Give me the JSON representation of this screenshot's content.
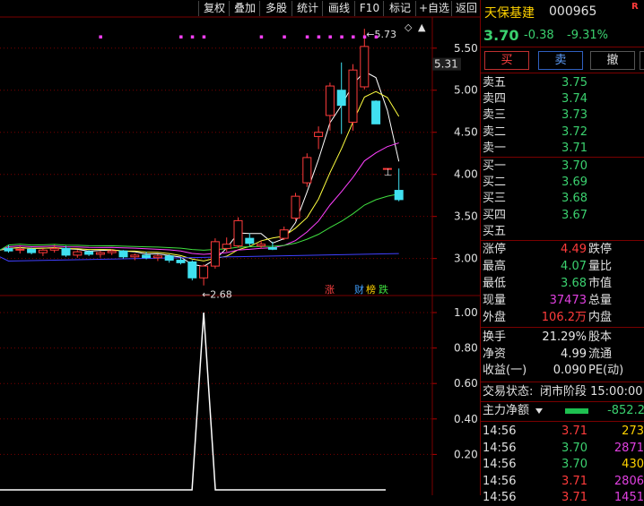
{
  "toolbar": {
    "items": [
      "复权",
      "叠加",
      "多股",
      "统计",
      "画线",
      "F10",
      "标记",
      "+自选",
      "返回"
    ]
  },
  "chart_data": [
    {
      "type": "candlestick",
      "title": "",
      "y_ticks": [
        "5.50",
        "5.00",
        "4.50",
        "4.00",
        "3.50",
        "3.00"
      ],
      "ylim": [
        2.56,
        5.87
      ],
      "last_close_tag": "5.31",
      "annotations": {
        "high": "5.73",
        "low": "2.68",
        "high_marker": "←",
        "low_marker": "←",
        "right_marker": "⊥",
        "marker_dots": "▪"
      },
      "signal_badges": [
        "涨",
        "财",
        "榜",
        "跌"
      ],
      "candles": [
        {
          "o": 3.12,
          "h": 3.16,
          "l": 3.07,
          "c": 3.09
        },
        {
          "o": 3.1,
          "h": 3.14,
          "l": 3.06,
          "c": 3.11
        },
        {
          "o": 3.11,
          "h": 3.13,
          "l": 3.05,
          "c": 3.07
        },
        {
          "o": 3.07,
          "h": 3.12,
          "l": 3.03,
          "c": 3.1
        },
        {
          "o": 3.1,
          "h": 3.16,
          "l": 3.07,
          "c": 3.12
        },
        {
          "o": 3.12,
          "h": 3.15,
          "l": 3.02,
          "c": 3.04
        },
        {
          "o": 3.04,
          "h": 3.1,
          "l": 3.01,
          "c": 3.08
        },
        {
          "o": 3.08,
          "h": 3.1,
          "l": 3.03,
          "c": 3.05
        },
        {
          "o": 3.05,
          "h": 3.09,
          "l": 3.01,
          "c": 3.07
        },
        {
          "o": 3.07,
          "h": 3.11,
          "l": 3.04,
          "c": 3.09
        },
        {
          "o": 3.09,
          "h": 3.1,
          "l": 3.0,
          "c": 3.02
        },
        {
          "o": 3.02,
          "h": 3.06,
          "l": 2.98,
          "c": 3.04
        },
        {
          "o": 3.04,
          "h": 3.08,
          "l": 2.99,
          "c": 3.01
        },
        {
          "o": 3.01,
          "h": 3.05,
          "l": 2.97,
          "c": 3.03
        },
        {
          "o": 3.03,
          "h": 3.05,
          "l": 2.95,
          "c": 2.98
        },
        {
          "o": 2.98,
          "h": 3.01,
          "l": 2.93,
          "c": 2.95
        },
        {
          "o": 2.96,
          "h": 2.98,
          "l": 2.74,
          "c": 2.77
        },
        {
          "o": 2.77,
          "h": 2.93,
          "l": 2.68,
          "c": 2.91
        },
        {
          "o": 2.91,
          "h": 3.24,
          "l": 2.88,
          "c": 3.2
        },
        {
          "o": 3.12,
          "h": 3.25,
          "l": 3.08,
          "c": 3.17
        },
        {
          "o": 3.15,
          "h": 3.49,
          "l": 3.13,
          "c": 3.45
        },
        {
          "o": 3.24,
          "h": 3.3,
          "l": 3.15,
          "c": 3.18
        },
        {
          "o": 3.15,
          "h": 3.21,
          "l": 3.12,
          "c": 3.17
        },
        {
          "o": 3.13,
          "h": 3.2,
          "l": 3.1,
          "c": 3.11
        },
        {
          "o": 3.24,
          "h": 3.38,
          "l": 3.22,
          "c": 3.34
        },
        {
          "o": 3.48,
          "h": 3.78,
          "l": 3.45,
          "c": 3.74
        },
        {
          "o": 3.9,
          "h": 4.25,
          "l": 3.85,
          "c": 4.2
        },
        {
          "o": 4.45,
          "h": 4.57,
          "l": 4.3,
          "c": 4.5
        },
        {
          "o": 4.7,
          "h": 5.09,
          "l": 4.52,
          "c": 5.05
        },
        {
          "o": 5.0,
          "h": 5.33,
          "l": 4.48,
          "c": 4.82
        },
        {
          "o": 4.62,
          "h": 5.31,
          "l": 4.52,
          "c": 5.24
        },
        {
          "o": 5.04,
          "h": 5.73,
          "l": 5.01,
          "c": 5.52
        },
        {
          "o": 4.87,
          "h": 4.88,
          "l": 4.78,
          "c": 4.6
        },
        {
          "o": 4.07,
          "h": 4.07,
          "l": 4.07,
          "c": 4.07
        },
        {
          "o": 3.81,
          "h": 4.07,
          "l": 3.68,
          "c": 3.7
        }
      ],
      "ma_lines": [
        "white",
        "yellow",
        "magenta",
        "green",
        "blue"
      ]
    },
    {
      "type": "line",
      "title": "",
      "y_ticks": [
        "1.00",
        "0.80",
        "0.60",
        "0.40",
        "0.20"
      ],
      "ylim": [
        0.0,
        1.0
      ],
      "series": [
        {
          "values": [
            0,
            0,
            0,
            0,
            0,
            0,
            0,
            0,
            0,
            0,
            0,
            0,
            0,
            0,
            0,
            0,
            0,
            1,
            0,
            0,
            0,
            0,
            0,
            0,
            0,
            0,
            0,
            0,
            0,
            0,
            0,
            0,
            0,
            0,
            0
          ]
        }
      ]
    }
  ],
  "quote": {
    "name": "天保基建",
    "code": "000965",
    "flag": "R",
    "price": "3.70",
    "change": "-0.38",
    "pct": "-9.31%",
    "buy": "买",
    "sell": "卖",
    "cancel": "撤",
    "asks": [
      {
        "label": "卖五",
        "price": "3.75"
      },
      {
        "label": "卖四",
        "price": "3.74"
      },
      {
        "label": "卖三",
        "price": "3.73"
      },
      {
        "label": "卖二",
        "price": "3.72"
      },
      {
        "label": "卖一",
        "price": "3.71"
      }
    ],
    "bids": [
      {
        "label": "买一",
        "price": "3.70"
      },
      {
        "label": "买二",
        "price": "3.69"
      },
      {
        "label": "买三",
        "price": "3.68"
      },
      {
        "label": "买四",
        "price": "3.67"
      },
      {
        "label": "买五",
        "price": ""
      }
    ],
    "stats": [
      {
        "l1": "涨停",
        "v1": "4.49",
        "l2": "跌停"
      },
      {
        "l1": "最高",
        "v1": "4.07",
        "l2": "量比"
      },
      {
        "l1": "最低",
        "v1": "3.68",
        "l2": "市值"
      },
      {
        "l1": "现量",
        "v1": "37473",
        "l2": "总量"
      },
      {
        "l1": "外盘",
        "v1": "106.2万",
        "l2": "内盘"
      }
    ],
    "stats2": [
      {
        "l1": "换手",
        "v1": "21.29%",
        "l2": "股本"
      },
      {
        "l1": "净资",
        "v1": "4.99",
        "l2": "流通"
      },
      {
        "l1": "收益(一)",
        "v1": "0.090",
        "l2": "PE(动)"
      }
    ],
    "status_label": "交易状态:",
    "status_value": "闭市阶段 15:00:00",
    "main_flow_label": "主力净额",
    "main_flow_value": "-852.2",
    "ticks": [
      {
        "time": "14:56",
        "price": "3.71",
        "vol": "273"
      },
      {
        "time": "14:56",
        "price": "3.70",
        "vol": "2871"
      },
      {
        "time": "14:56",
        "price": "3.70",
        "vol": "430"
      },
      {
        "time": "14:56",
        "price": "3.71",
        "vol": "2806"
      },
      {
        "time": "14:56",
        "price": "3.71",
        "vol": "1451"
      }
    ],
    "colors": {
      "up": "#ff3b3b",
      "down": "#3bd16f",
      "accent": "#ffd200",
      "grid": "#7a0000",
      "cyan": "#40e0f0"
    }
  }
}
